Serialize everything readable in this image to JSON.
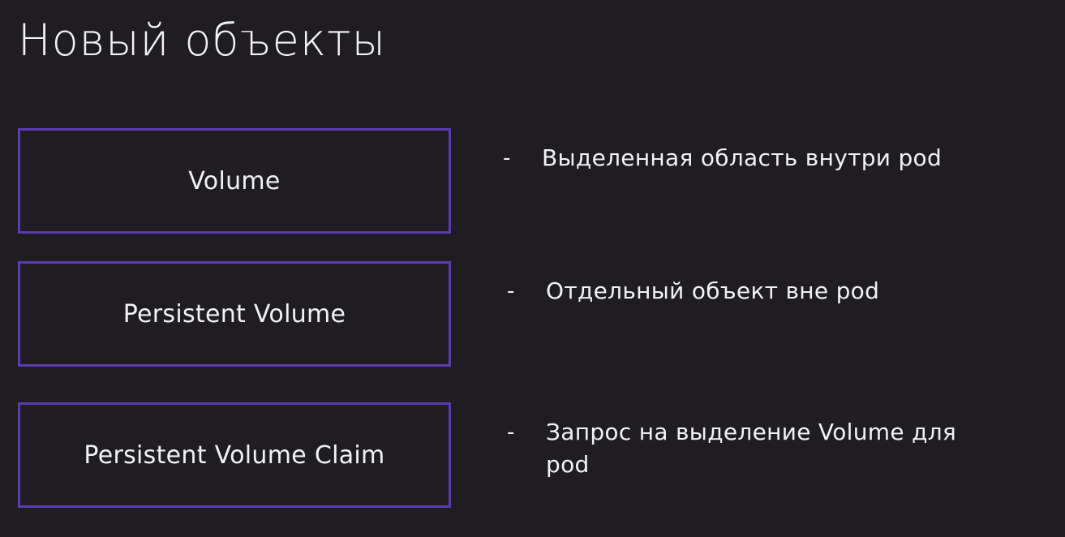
{
  "slide": {
    "title": "Новый объекты",
    "rows": [
      {
        "term": "Volume",
        "bullet": "-",
        "description": "Выделенная область внутри pod"
      },
      {
        "term": "Persistent Volume",
        "bullet": "-",
        "description": "Отдельный объект вне pod"
      },
      {
        "term": "Persistent Volume Claim",
        "bullet": "-",
        "description": "Запрос на выделение Volume для pod"
      }
    ]
  },
  "colors": {
    "background": "#1f1d22",
    "box_border": "#5b3bb0",
    "text": "#f2f2f2"
  }
}
